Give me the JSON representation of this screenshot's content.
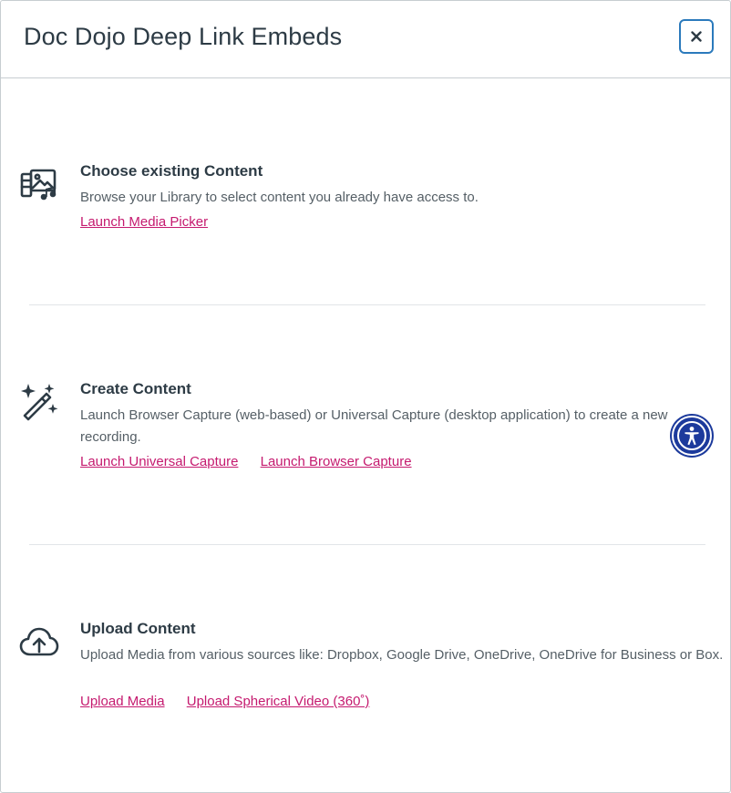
{
  "dialog": {
    "title": "Doc Dojo Deep Link Embeds",
    "close_label": "×"
  },
  "sections": [
    {
      "icon": "media-library-icon",
      "title": "Choose existing Content",
      "description": "Browse your Library to select content you already have access to.",
      "links": [
        "Launch Media Picker"
      ]
    },
    {
      "icon": "magic-wand-icon",
      "title": "Create Content",
      "description": "Launch Browser Capture (web-based) or Universal Capture (desktop application) to create a new recording.",
      "links": [
        "Launch Universal Capture",
        "Launch Browser Capture"
      ]
    },
    {
      "icon": "cloud-upload-icon",
      "title": "Upload Content",
      "description": "Upload Media from various sources like: Dropbox, Google Drive, OneDrive, OneDrive for Business or Box.",
      "links": [
        "Upload Media",
        "Upload Spherical Video (360˚)"
      ]
    }
  ],
  "colors": {
    "link": "#c51a6f",
    "accent_border": "#2b7abc",
    "accessibility_button": "#1c3a9c"
  }
}
